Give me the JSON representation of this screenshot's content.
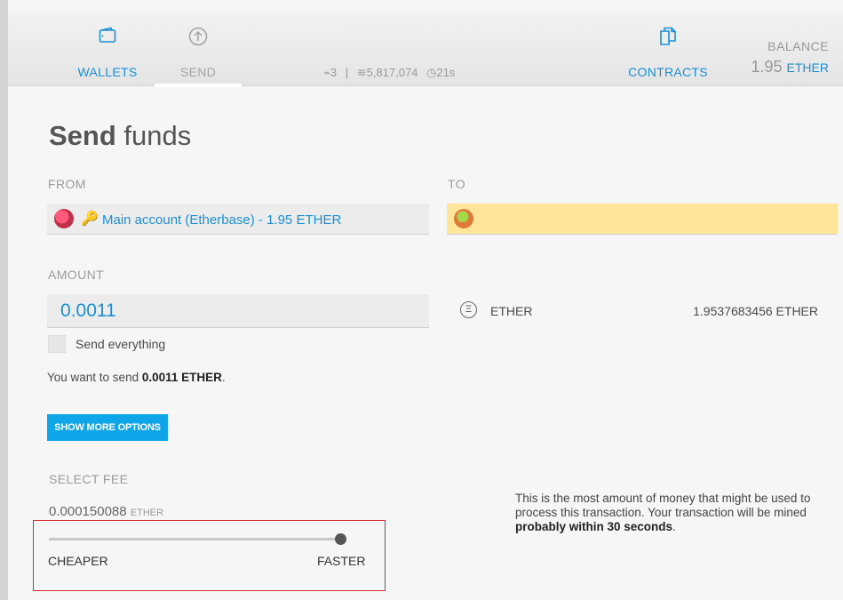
{
  "header": {
    "nav": {
      "wallets": "WALLETS",
      "send": "SEND",
      "contracts": "CONTRACTS"
    },
    "status": {
      "peers": "3",
      "block": "5,817,074",
      "time": "21s"
    },
    "balance": {
      "label": "BALANCE",
      "value": "1.95",
      "unit": "ETHER"
    }
  },
  "send": {
    "title_bold": "Send",
    "title_rest": "funds",
    "from_label": "FROM",
    "from_account": "Main account (Etherbase) - 1.95 ETHER",
    "to_label": "TO",
    "to_value": "",
    "amount_label": "AMOUNT",
    "amount_value": "0.0011",
    "send_everything_label": "Send everything",
    "send_everything_checked": false,
    "want_prefix": "You want to send",
    "want_amount": "0.0011 ETHER",
    "want_suffix": ".",
    "currency_symbol": "Ξ",
    "currency_name": "ETHER",
    "currency_balance": "1.9537683456 ETHER",
    "more_options_button": "SHOW MORE OPTIONS"
  },
  "fee": {
    "label": "SELECT FEE",
    "value": "0.000150088",
    "unit": "ETHER",
    "slider_level": 1.0,
    "cheaper_label": "CHEAPER",
    "faster_label": "FASTER",
    "note_text": "This is the most amount of money that might be used to process this transaction. Your transaction will be mined",
    "note_bold": "probably within 30 seconds",
    "note_end": "."
  },
  "colors": {
    "accent": "#1a8fd5",
    "button": "#0ea5e9",
    "to_field": "#ffe59a",
    "highlight_box": "#d42a2a"
  }
}
